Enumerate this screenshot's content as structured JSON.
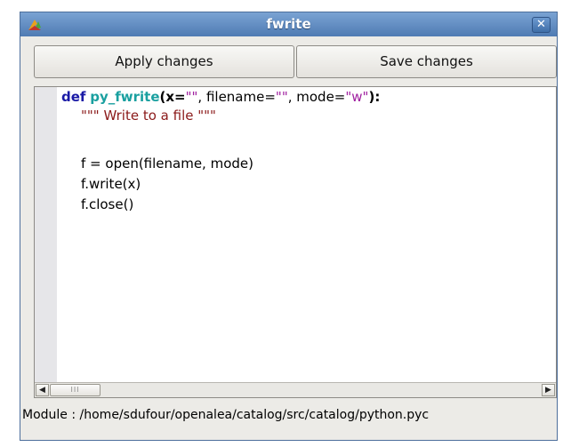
{
  "window": {
    "title": "fwrite",
    "close_glyph": "✕"
  },
  "toolbar": {
    "apply_label": "Apply changes",
    "save_label": "Save changes"
  },
  "editor": {
    "line1": {
      "kw": "def",
      "fn": "py_fwrite",
      "p1": "(x=",
      "s1": "\"\"",
      "p2": ", filename=",
      "s2": "\"\"",
      "p3": ", mode=",
      "s3": "\"w\"",
      "p4": "):"
    },
    "line2": "\"\"\" Write to a file \"\"\"",
    "line3": "f = open(filename, mode)",
    "line4": "f.write(x)",
    "line5": "f.close()"
  },
  "scrollbar": {
    "left_glyph": "◀",
    "right_glyph": "▶",
    "thumb_grip": "III"
  },
  "status": {
    "module_path": "Module : /home/sdufour/openalea/catalog/src/catalog/python.pyc"
  }
}
